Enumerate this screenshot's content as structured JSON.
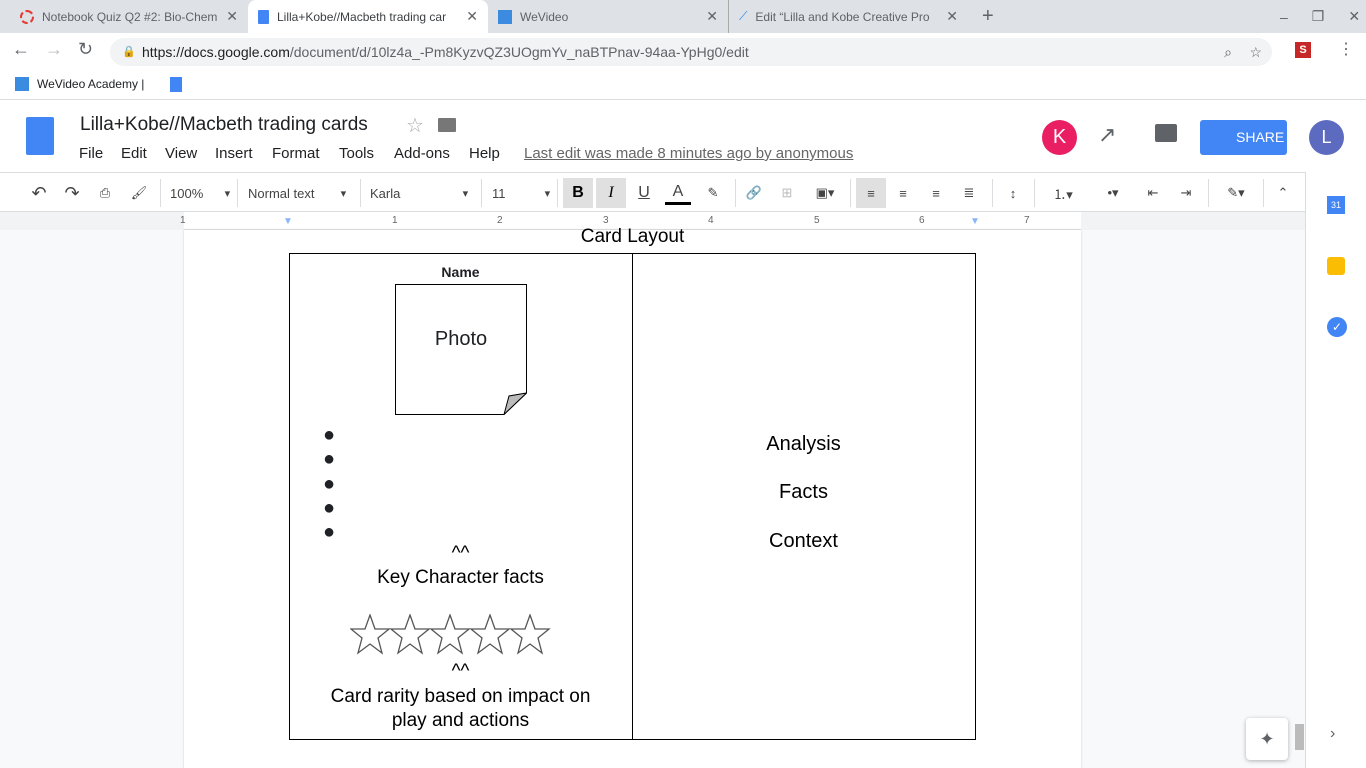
{
  "browser": {
    "tabs": [
      {
        "title": "Notebook Quiz Q2 #2: Bio-Chem",
        "icon": "quiz-icon"
      },
      {
        "title": "Lilla+Kobe//Macbeth trading car",
        "icon": "docs-icon",
        "active": true
      },
      {
        "title": "WeVideo",
        "icon": "wevideo-icon"
      },
      {
        "title": "Edit “Lilla and Kobe Creative Pro",
        "icon": "edit-icon"
      }
    ],
    "url_host": "https://docs.google.com",
    "url_path": "/document/d/10lz4a_-Pm8KyzvQZ3UOgmYv_naBTPnav-94aa-YpHg0/edit",
    "bookmarks": [
      {
        "label": "WeVideo Academy |"
      },
      {
        "label": ""
      }
    ],
    "extension_label": "S"
  },
  "docs": {
    "title": "Lilla+Kobe//Macbeth trading cards",
    "menus": [
      "File",
      "Edit",
      "View",
      "Insert",
      "Format",
      "Tools",
      "Add-ons",
      "Help"
    ],
    "last_edit": "Last edit was made 8 minutes ago by anonymous",
    "user_initial": "K",
    "account_initial": "L",
    "share_label": "SHARE",
    "colors": {
      "accent": "#1a73e8",
      "share": "#4285f4",
      "user_avatar": "#e91e63",
      "account_avatar": "#5c6bc0"
    }
  },
  "toolbar": {
    "zoom": "100%",
    "style": "Normal text",
    "font": "Karla",
    "size": "11"
  },
  "ruler": {
    "labels": [
      "1",
      "1",
      "2",
      "3",
      "4",
      "5",
      "6",
      "7"
    ]
  },
  "document": {
    "heading": "Card Layout",
    "name_label": "Name",
    "photo_label": "Photo",
    "bullet_count": 5,
    "caret1": "^^",
    "key_facts": "Key Character facts",
    "star_count": 5,
    "caret2": "^^",
    "rarity_line1": "Card rarity based on impact on",
    "rarity_line2": "play and actions",
    "right": [
      "Analysis",
      "Facts",
      "Context"
    ]
  }
}
